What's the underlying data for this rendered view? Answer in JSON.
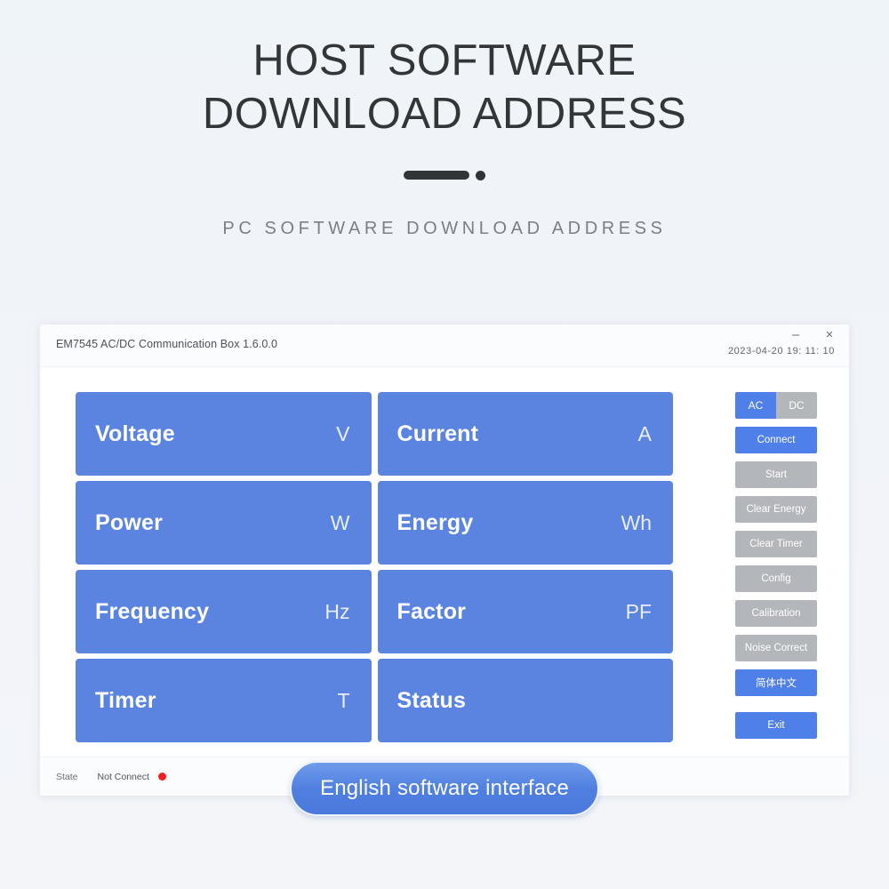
{
  "header": {
    "title_line1": "HOST SOFTWARE",
    "title_line2": "DOWNLOAD ADDRESS",
    "subtitle": "PC SOFTWARE DOWNLOAD ADDRESS"
  },
  "app": {
    "title": "EM7545 AC/DC Communication Box   1.6.0.0",
    "timestamp": "2023-04-20  19: 11: 10",
    "window_controls": {
      "minimize": "–",
      "close": "×"
    },
    "tiles": [
      {
        "label": "Voltage",
        "unit": "V"
      },
      {
        "label": "Current",
        "unit": "A"
      },
      {
        "label": "Power",
        "unit": "W"
      },
      {
        "label": "Energy",
        "unit": "Wh"
      },
      {
        "label": "Frequency",
        "unit": "Hz"
      },
      {
        "label": "Factor",
        "unit": "PF"
      },
      {
        "label": "Timer",
        "unit": "T"
      },
      {
        "label": "Status",
        "unit": ""
      }
    ],
    "mode_toggle": {
      "ac": "AC",
      "dc": "DC",
      "selected": "AC"
    },
    "buttons": [
      {
        "label": "Connect",
        "style": "blue"
      },
      {
        "label": "Start",
        "style": "gray"
      },
      {
        "label": "Clear Energy",
        "style": "gray"
      },
      {
        "label": "Clear Timer",
        "style": "gray"
      },
      {
        "label": "Config",
        "style": "gray"
      },
      {
        "label": "Calibration",
        "style": "gray"
      },
      {
        "label": "Noise Correct",
        "style": "gray"
      },
      {
        "label": "简体中文",
        "style": "blue"
      },
      {
        "label": "Exit",
        "style": "blue"
      }
    ],
    "status": {
      "label": "State",
      "value": "Not Connect",
      "indicator_color": "#ee2222"
    }
  },
  "caption": {
    "text": "English software interface"
  },
  "colors": {
    "tile_blue": "#5a84df",
    "button_blue": "#4f7fe8",
    "button_gray": "#b3b6bb",
    "page_background": "#f0f4f8",
    "title_text": "#333639",
    "subtitle_text": "#7a7f86"
  }
}
